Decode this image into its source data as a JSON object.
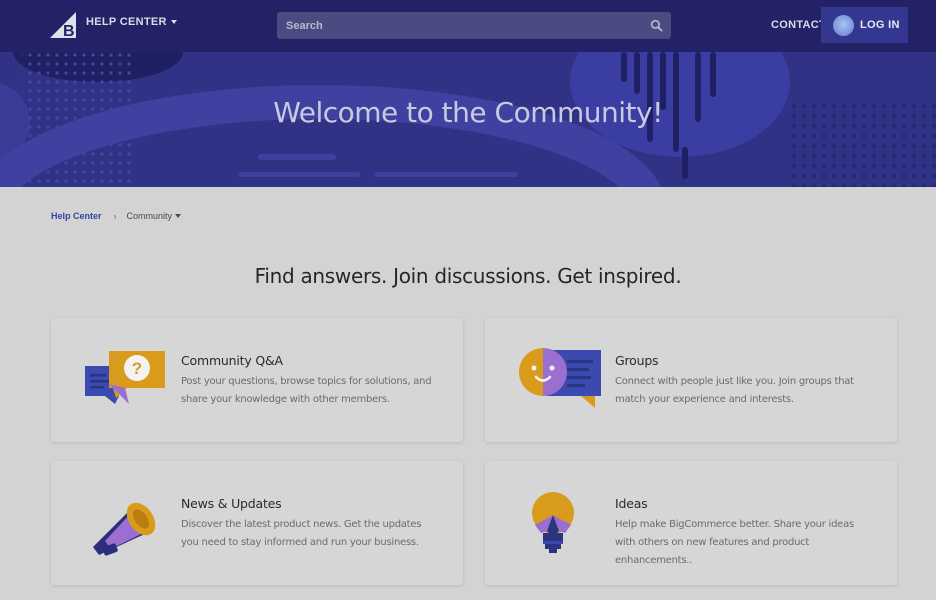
{
  "header": {
    "help_center_label": "HELP CENTER",
    "search_placeholder": "Search",
    "contact_label": "CONTACT",
    "login_label": "LOG IN"
  },
  "hero": {
    "title": "Welcome to the Community!"
  },
  "breadcrumb": {
    "home": "Help Center",
    "separator": "›",
    "current": "Community"
  },
  "tagline": "Find answers. Join discussions. Get inspired.",
  "cards": [
    {
      "icon": "speech-bubbles-question-icon",
      "title": "Community Q&A",
      "description": "Post your questions, browse topics for solutions, and share your knowledge with other members."
    },
    {
      "icon": "groups-icon",
      "title": "Groups",
      "description": "Connect with people just like you. Join groups that match your experience and interests."
    },
    {
      "icon": "megaphone-icon",
      "title": "News & Updates",
      "description": "Discover the latest product news. Get the updates you need to stay informed and run your business."
    },
    {
      "icon": "lightbulb-icon",
      "title": "Ideas",
      "description": "Help make BigCommerce better. Share your ideas with others on new features and product enhancements.."
    }
  ],
  "colors": {
    "header_bg": "#232266",
    "hero_bg": "#2f3285",
    "link_blue": "#2d46a8",
    "page_bg": "#d3d3d3",
    "card_bg": "#d6d6d6"
  }
}
